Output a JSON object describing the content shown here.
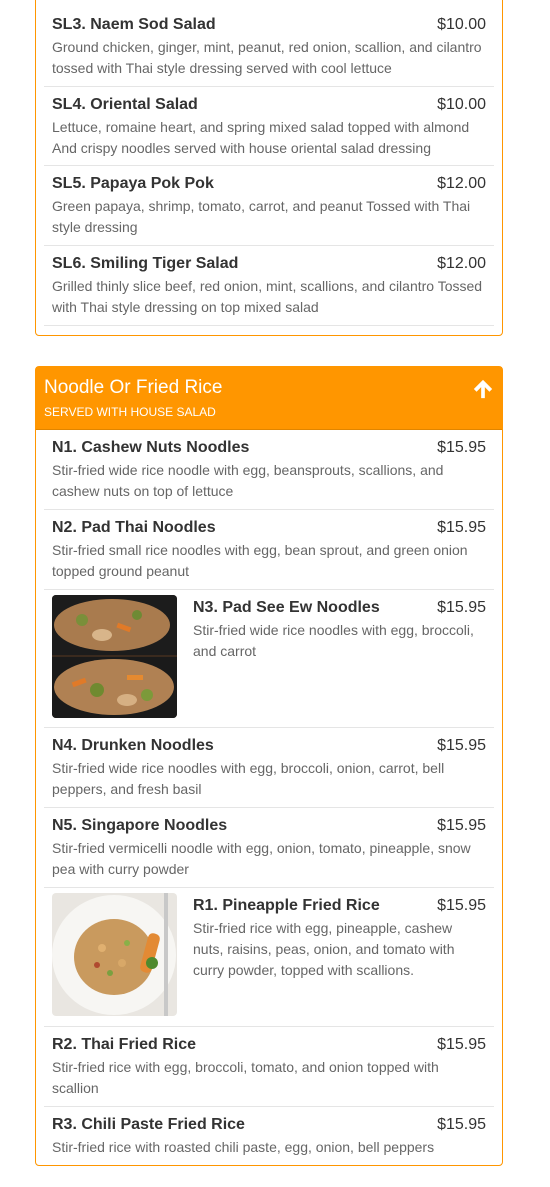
{
  "salad_section": {
    "items": [
      {
        "name": "SL3. Naem Sod Salad",
        "price": "$10.00",
        "desc": "Ground chicken, ginger, mint, peanut, red onion, scallion, and cilantro tossed with Thai style dressing served with cool lettuce"
      },
      {
        "name": "SL4. Oriental Salad",
        "price": "$10.00",
        "desc": "Lettuce, romaine heart, and spring mixed salad topped with almond And crispy noodles served with house oriental salad dressing"
      },
      {
        "name": "SL5. Papaya Pok Pok",
        "price": "$12.00",
        "desc": "Green papaya, shrimp, tomato, carrot, and peanut Tossed with Thai style dressing"
      },
      {
        "name": "SL6. Smiling Tiger Salad",
        "price": "$12.00",
        "desc": "Grilled thinly slice beef, red onion, mint, scallions, and cilantro Tossed with Thai style dressing on top mixed salad"
      }
    ]
  },
  "noodle_section": {
    "title": "Noodle Or Fried Rice",
    "subtitle": "SERVED WITH HOUSE SALAD",
    "up_icon": "arrow-up-icon",
    "accent": "#ff9600",
    "items": [
      {
        "name": "N1. Cashew Nuts Noodles",
        "price": "$15.95",
        "desc": "Stir-fried wide rice noodle with egg, beansprouts, scallions, and cashew nuts on top of lettuce"
      },
      {
        "name": "N2. Pad Thai Noodles",
        "price": "$15.95",
        "desc": "Stir-fried small rice noodles with egg, bean sprout, and green onion topped ground peanut"
      },
      {
        "name": "N3. Pad See Ew Noodles",
        "price": "$15.95",
        "desc": "Stir-fried wide rice noodles with egg, broccoli, and carrot"
      },
      {
        "name": "N4. Drunken Noodles",
        "price": "$15.95",
        "desc": "Stir-fried wide rice noodles with egg, broccoli, onion, carrot, bell peppers, and fresh basil"
      },
      {
        "name": "N5. Singapore Noodles",
        "price": "$15.95",
        "desc": "Stir-fried vermicelli noodle with egg, onion, tomato, pineapple, snow pea with curry powder"
      },
      {
        "name": "R1. Pineapple Fried Rice",
        "price": "$15.95",
        "desc": "Stir-fried rice with egg, pineapple, cashew nuts, raisins, peas, onion, and tomato with curry powder, topped with scallions."
      },
      {
        "name": "R2. Thai Fried Rice",
        "price": "$15.95",
        "desc": "Stir-fried rice with egg, broccoli, tomato, and onion topped with scallion"
      },
      {
        "name": "R3. Chili Paste Fried Rice",
        "price": "$15.95",
        "desc": "Stir-fried rice with roasted chili paste, egg, onion, bell peppers"
      }
    ]
  }
}
